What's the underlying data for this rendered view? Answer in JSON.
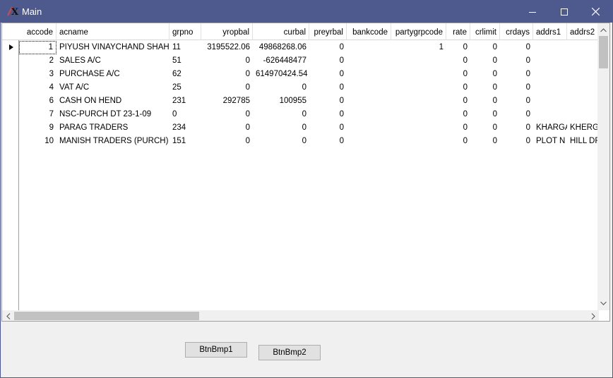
{
  "window": {
    "title": "Main",
    "icon": "app-x-icon",
    "controls": {
      "minimize": "minimize-icon",
      "maximize": "maximize-icon",
      "close": "close-icon"
    }
  },
  "grid": {
    "columns": [
      "accode",
      "acname",
      "grpno",
      "yropbal",
      "curbal",
      "preyrbal",
      "bankcode",
      "partygrpcode",
      "rate",
      "crlimit",
      "crdays",
      "addrs1",
      "addrs2"
    ],
    "rows": [
      [
        "1",
        "PIYUSH VINAYCHAND SHAH",
        "11",
        "3195522.06",
        "49868268.06",
        "0",
        "",
        "1",
        "0",
        "0",
        "0",
        "",
        ""
      ],
      [
        "2",
        "SALES A/C",
        "51",
        "0",
        "-626448477",
        "0",
        "",
        "",
        "0",
        "0",
        "0",
        "",
        ""
      ],
      [
        "3",
        "PURCHASE A/C",
        "62",
        "0",
        "614970424.54",
        "0",
        "",
        "",
        "0",
        "0",
        "0",
        "",
        ""
      ],
      [
        "4",
        "VAT A/C",
        "25",
        "0",
        "0",
        "0",
        "",
        "",
        "0",
        "0",
        "0",
        "",
        ""
      ],
      [
        "6",
        "CASH ON HEND",
        "231",
        "292785",
        "100955",
        "0",
        "",
        "",
        "0",
        "0",
        "0",
        "",
        ""
      ],
      [
        "7",
        "NSC-PURCH DT 23-1-09",
        "0",
        "0",
        "0",
        "0",
        "",
        "",
        "0",
        "0",
        "0",
        "",
        ""
      ],
      [
        "9",
        "PARAG TRADERS",
        "234",
        "0",
        "0",
        "0",
        "",
        "",
        "0",
        "0",
        "0",
        "KHARGA",
        "KHERGA"
      ],
      [
        "10",
        "MANISH TRADERS (PURCH)",
        "151",
        "0",
        "0",
        "0",
        "",
        "",
        "0",
        "0",
        "0",
        "PLOT N",
        "HILL DR"
      ]
    ],
    "current_row_icon": "row-pointer-icon"
  },
  "buttons": {
    "btn1": "BtnBmp1",
    "btn2": "BtnBmp2"
  }
}
